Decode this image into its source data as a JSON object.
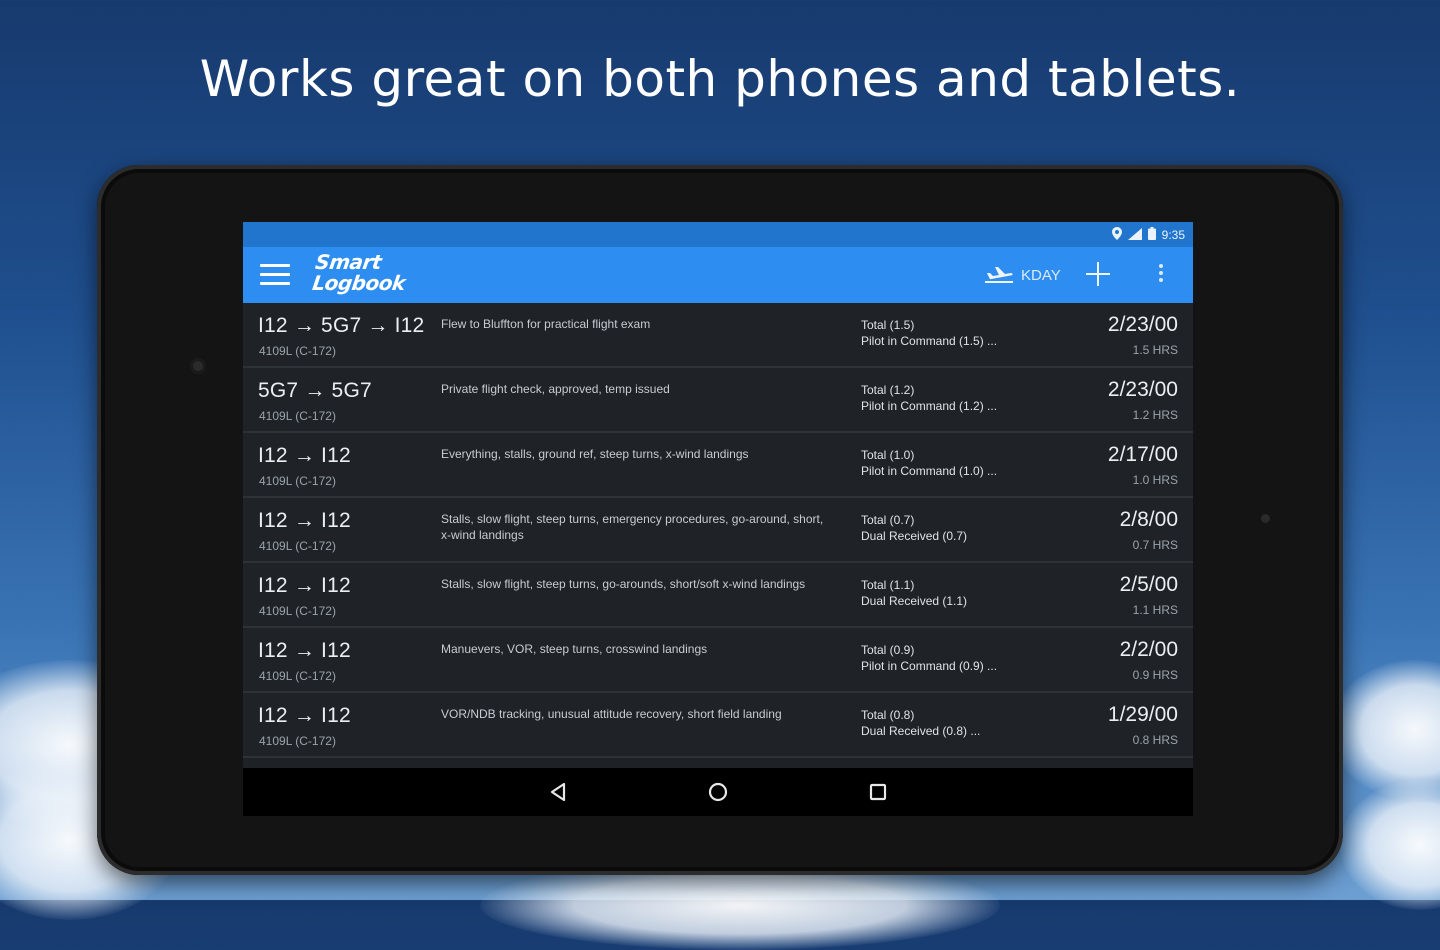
{
  "headline": "Works great on both phones and tablets.",
  "status_bar": {
    "time": "9:35",
    "icons": [
      "location-icon",
      "signal-icon",
      "battery-icon"
    ]
  },
  "app_bar": {
    "logo_line1": "Smart",
    "logo_line2": "Logbook",
    "airport": "KDAY",
    "icons": [
      "menu-icon",
      "airplane-icon",
      "add-icon",
      "more-vert-icon"
    ]
  },
  "flights": [
    {
      "route": "I12 → 5G7 → I12",
      "aircraft": "4109L (C-172)",
      "remarks": "Flew to Bluffton for practical flight exam",
      "time1": "Total (1.5)",
      "time2": "Pilot in Command (1.5) ...",
      "date": "2/23/00",
      "hrs": "1.5 HRS"
    },
    {
      "route": "5G7 → 5G7",
      "aircraft": "4109L (C-172)",
      "remarks": "Private flight check, approved, temp issued",
      "time1": "Total (1.2)",
      "time2": "Pilot in Command (1.2) ...",
      "date": "2/23/00",
      "hrs": "1.2 HRS"
    },
    {
      "route": "I12 → I12",
      "aircraft": "4109L (C-172)",
      "remarks": "Everything, stalls, ground ref, steep turns, x-wind landings",
      "time1": "Total (1.0)",
      "time2": "Pilot in Command (1.0) ...",
      "date": "2/17/00",
      "hrs": "1.0 HRS"
    },
    {
      "route": "I12 → I12",
      "aircraft": "4109L (C-172)",
      "remarks": "Stalls, slow flight, steep turns, emergency procedures, go-around, short, x-wind landings",
      "time1": "Total (0.7)",
      "time2": "Dual Received (0.7)",
      "date": "2/8/00",
      "hrs": "0.7 HRS"
    },
    {
      "route": "I12 → I12",
      "aircraft": "4109L (C-172)",
      "remarks": "Stalls, slow flight, steep turns, go-arounds, short/soft x-wind landings",
      "time1": "Total (1.1)",
      "time2": "Dual Received (1.1)",
      "date": "2/5/00",
      "hrs": "1.1 HRS"
    },
    {
      "route": "I12 → I12",
      "aircraft": "4109L (C-172)",
      "remarks": "Manuevers, VOR, steep turns, crosswind landings",
      "time1": "Total (0.9)",
      "time2": "Pilot in Command (0.9) ...",
      "date": "2/2/00",
      "hrs": "0.9 HRS"
    },
    {
      "route": "I12 → I12",
      "aircraft": "4109L (C-172)",
      "remarks": "VOR/NDB tracking, unusual attitude recovery, short field landing",
      "time1": "Total (0.8)",
      "time2": "Dual Received (0.8) ...",
      "date": "1/29/00",
      "hrs": "0.8 HRS"
    }
  ],
  "nav_bar": {
    "icons": [
      "back-icon",
      "home-icon",
      "recents-icon"
    ]
  },
  "colors": {
    "status_bar": "#2175cc",
    "app_bar": "#2d8df0",
    "list_background": "#1f2327",
    "nav_bar": "#000000"
  }
}
